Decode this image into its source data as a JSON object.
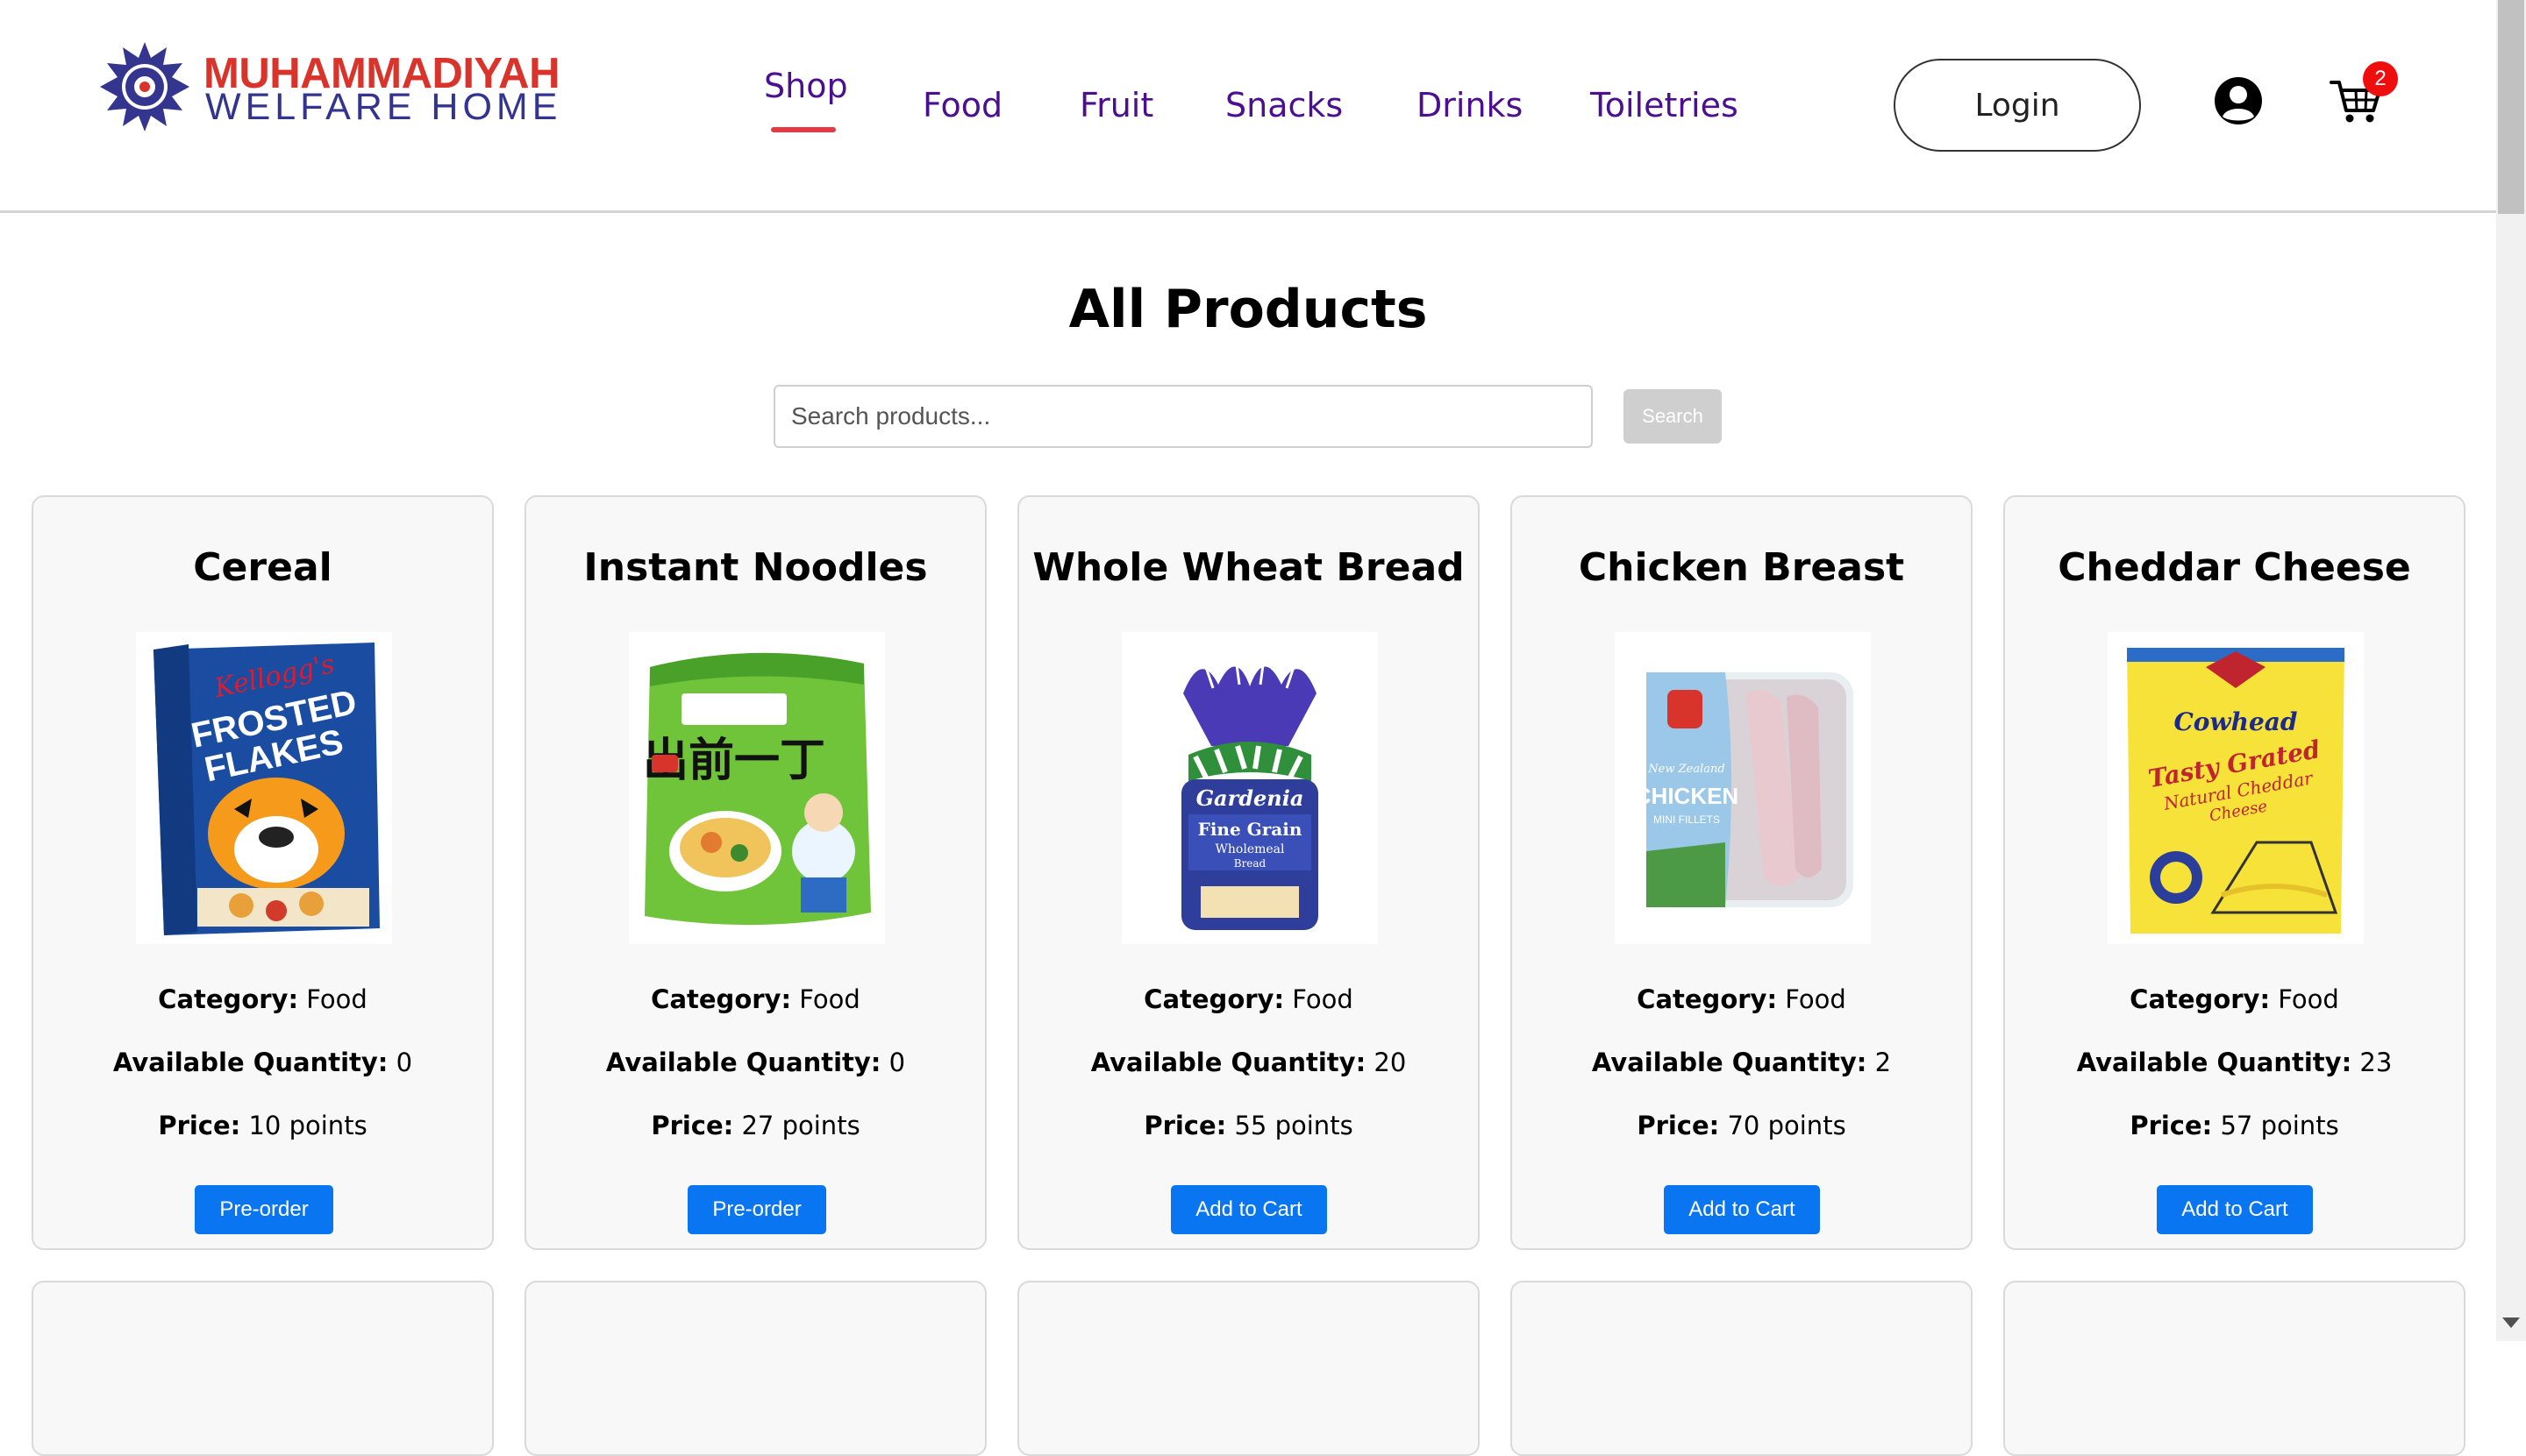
{
  "logo": {
    "line1": "MUHAMMADIYAH",
    "line2": "WELFARE HOME"
  },
  "nav": [
    {
      "label": "Shop",
      "active": true
    },
    {
      "label": "Food"
    },
    {
      "label": "Fruit"
    },
    {
      "label": "Snacks"
    },
    {
      "label": "Drinks"
    },
    {
      "label": "Toiletries"
    }
  ],
  "header": {
    "login_label": "Login",
    "user_icon": "user-circle-icon",
    "cart_icon": "shopping-cart-icon",
    "cart_count": "2"
  },
  "main": {
    "title": "All Products",
    "search": {
      "placeholder": "Search products...",
      "value": "",
      "button_label": "Search"
    }
  },
  "labels": {
    "category": "Category:",
    "quantity": "Available Quantity:",
    "price": "Price:"
  },
  "products": [
    {
      "name": "Cereal",
      "category": "Food",
      "quantity": "0",
      "price": "10 points",
      "action": "Pre-order",
      "image_icon": "cereal-box-image"
    },
    {
      "name": "Instant Noodles",
      "category": "Food",
      "quantity": "0",
      "price": "27 points",
      "action": "Pre-order",
      "image_icon": "noodle-pack-image"
    },
    {
      "name": "Whole Wheat Bread",
      "category": "Food",
      "quantity": "20",
      "price": "55 points",
      "action": "Add to Cart",
      "image_icon": "bread-loaf-image"
    },
    {
      "name": "Chicken Breast",
      "category": "Food",
      "quantity": "2",
      "price": "70 points",
      "action": "Add to Cart",
      "image_icon": "chicken-pack-image"
    },
    {
      "name": "Cheddar Cheese",
      "category": "Food",
      "quantity": "23",
      "price": "57 points",
      "action": "Add to Cart",
      "image_icon": "cheese-bag-image"
    }
  ],
  "image_text": {
    "cereal": [
      "Kellogg's",
      "FROSTED",
      "FLAKES"
    ],
    "noodles": [
      "出前一丁"
    ],
    "bread": [
      "Gardenia",
      "Fine Grain",
      "Wholemeal",
      "Bread"
    ],
    "chicken": [
      "New Zealand",
      "CHICKEN",
      "MINI FILLETS"
    ],
    "cheese": [
      "Cowhead",
      "Tasty Grated",
      "Natural Cheddar",
      "Cheese"
    ]
  },
  "colors": {
    "nav_text": "#4b0f8f",
    "nav_active_underline": "#e53a43",
    "button_blue": "#0a75f0",
    "badge_red": "#f00d0d",
    "logo_red": "#d8342b",
    "logo_blue": "#33348f"
  }
}
